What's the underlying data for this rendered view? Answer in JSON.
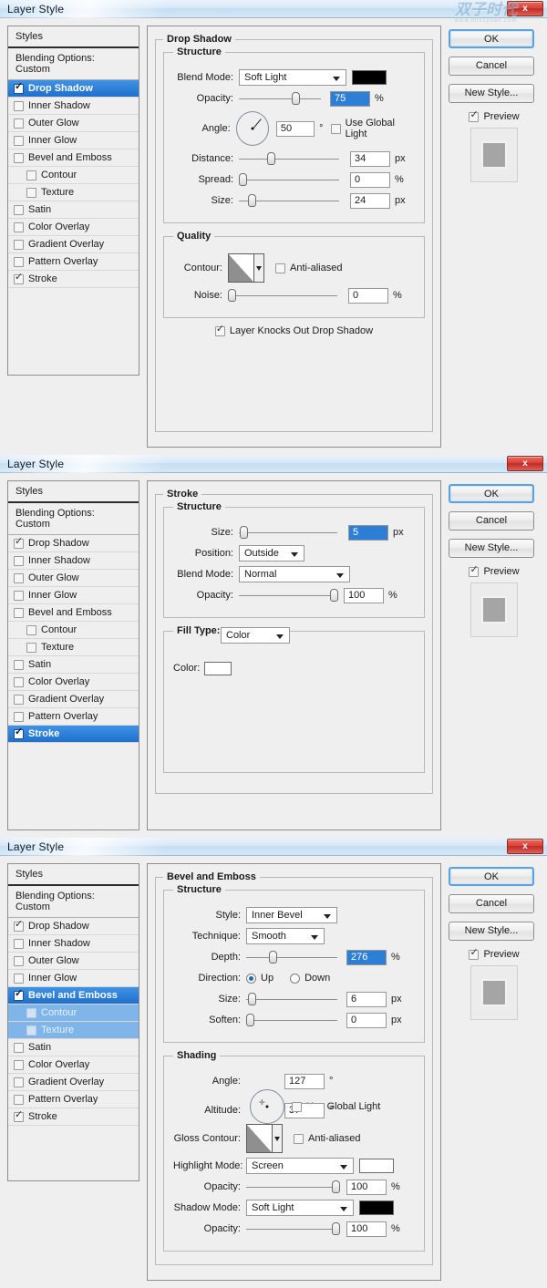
{
  "dialogs": [
    {
      "title": "Layer Style",
      "close_label": "x",
      "styles": {
        "header": "Styles",
        "blending_options": "Blending Options: Custom",
        "items": [
          {
            "label": "Drop Shadow",
            "checked": true,
            "selected": true,
            "sub": false
          },
          {
            "label": "Inner Shadow",
            "checked": false,
            "selected": false,
            "sub": false
          },
          {
            "label": "Outer Glow",
            "checked": false,
            "selected": false,
            "sub": false
          },
          {
            "label": "Inner Glow",
            "checked": false,
            "selected": false,
            "sub": false
          },
          {
            "label": "Bevel and Emboss",
            "checked": false,
            "selected": false,
            "sub": false
          },
          {
            "label": "Contour",
            "checked": false,
            "selected": false,
            "sub": true
          },
          {
            "label": "Texture",
            "checked": false,
            "selected": false,
            "sub": true
          },
          {
            "label": "Satin",
            "checked": false,
            "selected": false,
            "sub": false
          },
          {
            "label": "Color Overlay",
            "checked": false,
            "selected": false,
            "sub": false
          },
          {
            "label": "Gradient Overlay",
            "checked": false,
            "selected": false,
            "sub": false
          },
          {
            "label": "Pattern Overlay",
            "checked": false,
            "selected": false,
            "sub": false
          },
          {
            "label": "Stroke",
            "checked": true,
            "selected": false,
            "sub": false
          }
        ]
      },
      "panel": {
        "title": "Drop Shadow",
        "structure_legend": "Structure",
        "quality_legend": "Quality",
        "blend_mode_label": "Blend Mode:",
        "blend_mode_value": "Soft Light",
        "blend_color": "#000000",
        "opacity_label": "Opacity:",
        "opacity_value": "75",
        "opacity_unit": "%",
        "angle_label": "Angle:",
        "angle_value": "50",
        "angle_unit": "°",
        "use_global_light": "Use Global Light",
        "distance_label": "Distance:",
        "distance_value": "34",
        "distance_unit": "px",
        "spread_label": "Spread:",
        "spread_value": "0",
        "spread_unit": "%",
        "size_label": "Size:",
        "size_value": "24",
        "size_unit": "px",
        "contour_label": "Contour:",
        "anti_aliased": "Anti-aliased",
        "noise_label": "Noise:",
        "noise_value": "0",
        "noise_unit": "%",
        "knockout_label": "Layer Knocks Out Drop Shadow"
      },
      "buttons": {
        "ok": "OK",
        "cancel": "Cancel",
        "new_style": "New Style...",
        "preview": "Preview"
      },
      "watermark": {
        "text": "双子时代",
        "sub": "www.missyuan.com"
      }
    },
    {
      "title": "Layer Style",
      "close_label": "x",
      "styles": {
        "header": "Styles",
        "blending_options": "Blending Options: Custom",
        "items": [
          {
            "label": "Drop Shadow",
            "checked": true,
            "selected": false,
            "sub": false
          },
          {
            "label": "Inner Shadow",
            "checked": false,
            "selected": false,
            "sub": false
          },
          {
            "label": "Outer Glow",
            "checked": false,
            "selected": false,
            "sub": false
          },
          {
            "label": "Inner Glow",
            "checked": false,
            "selected": false,
            "sub": false
          },
          {
            "label": "Bevel and Emboss",
            "checked": false,
            "selected": false,
            "sub": false
          },
          {
            "label": "Contour",
            "checked": false,
            "selected": false,
            "sub": true
          },
          {
            "label": "Texture",
            "checked": false,
            "selected": false,
            "sub": true
          },
          {
            "label": "Satin",
            "checked": false,
            "selected": false,
            "sub": false
          },
          {
            "label": "Color Overlay",
            "checked": false,
            "selected": false,
            "sub": false
          },
          {
            "label": "Gradient Overlay",
            "checked": false,
            "selected": false,
            "sub": false
          },
          {
            "label": "Pattern Overlay",
            "checked": false,
            "selected": false,
            "sub": false
          },
          {
            "label": "Stroke",
            "checked": true,
            "selected": true,
            "sub": false
          }
        ]
      },
      "panel": {
        "title": "Stroke",
        "structure_legend": "Structure",
        "size_label": "Size:",
        "size_value": "5",
        "size_unit": "px",
        "position_label": "Position:",
        "position_value": "Outside",
        "blend_mode_label": "Blend Mode:",
        "blend_mode_value": "Normal",
        "opacity_label": "Opacity:",
        "opacity_value": "100",
        "opacity_unit": "%",
        "fill_type_label": "Fill Type:",
        "fill_type_value": "Color",
        "color_label": "Color:",
        "color_value": "#ffffff"
      },
      "buttons": {
        "ok": "OK",
        "cancel": "Cancel",
        "new_style": "New Style...",
        "preview": "Preview"
      }
    },
    {
      "title": "Layer Style",
      "close_label": "x",
      "styles": {
        "header": "Styles",
        "blending_options": "Blending Options: Custom",
        "items": [
          {
            "label": "Drop Shadow",
            "checked": true,
            "selected": false,
            "sub": false
          },
          {
            "label": "Inner Shadow",
            "checked": false,
            "selected": false,
            "sub": false
          },
          {
            "label": "Outer Glow",
            "checked": false,
            "selected": false,
            "sub": false
          },
          {
            "label": "Inner Glow",
            "checked": false,
            "selected": false,
            "sub": false
          },
          {
            "label": "Bevel and Emboss",
            "checked": true,
            "selected": true,
            "sub": false
          },
          {
            "label": "Contour",
            "checked": false,
            "selected": false,
            "sub": true,
            "subselected": true
          },
          {
            "label": "Texture",
            "checked": false,
            "selected": false,
            "sub": true,
            "subselected": true
          },
          {
            "label": "Satin",
            "checked": false,
            "selected": false,
            "sub": false
          },
          {
            "label": "Color Overlay",
            "checked": false,
            "selected": false,
            "sub": false
          },
          {
            "label": "Gradient Overlay",
            "checked": false,
            "selected": false,
            "sub": false
          },
          {
            "label": "Pattern Overlay",
            "checked": false,
            "selected": false,
            "sub": false
          },
          {
            "label": "Stroke",
            "checked": true,
            "selected": false,
            "sub": false
          }
        ]
      },
      "panel": {
        "title": "Bevel and Emboss",
        "structure_legend": "Structure",
        "shading_legend": "Shading",
        "style_label": "Style:",
        "style_value": "Inner Bevel",
        "technique_label": "Technique:",
        "technique_value": "Smooth",
        "depth_label": "Depth:",
        "depth_value": "276",
        "depth_unit": "%",
        "direction_label": "Direction:",
        "direction_up": "Up",
        "direction_down": "Down",
        "size_label": "Size:",
        "size_value": "6",
        "size_unit": "px",
        "soften_label": "Soften:",
        "soften_value": "0",
        "soften_unit": "px",
        "angle_label": "Angle:",
        "angle_value": "127",
        "angle_unit": "°",
        "use_global_light": "Use Global Light",
        "altitude_label": "Altitude:",
        "altitude_value": "37",
        "altitude_unit": "°",
        "gloss_contour_label": "Gloss Contour:",
        "anti_aliased": "Anti-aliased",
        "highlight_mode_label": "Highlight Mode:",
        "highlight_mode_value": "Screen",
        "highlight_color": "#ffffff",
        "highlight_opacity_label": "Opacity:",
        "highlight_opacity_value": "100",
        "highlight_opacity_unit": "%",
        "shadow_mode_label": "Shadow Mode:",
        "shadow_mode_value": "Soft Light",
        "shadow_color": "#000000",
        "shadow_opacity_label": "Opacity:",
        "shadow_opacity_value": "100",
        "shadow_opacity_unit": "%"
      },
      "buttons": {
        "ok": "OK",
        "cancel": "Cancel",
        "new_style": "New Style...",
        "preview": "Preview"
      }
    }
  ]
}
